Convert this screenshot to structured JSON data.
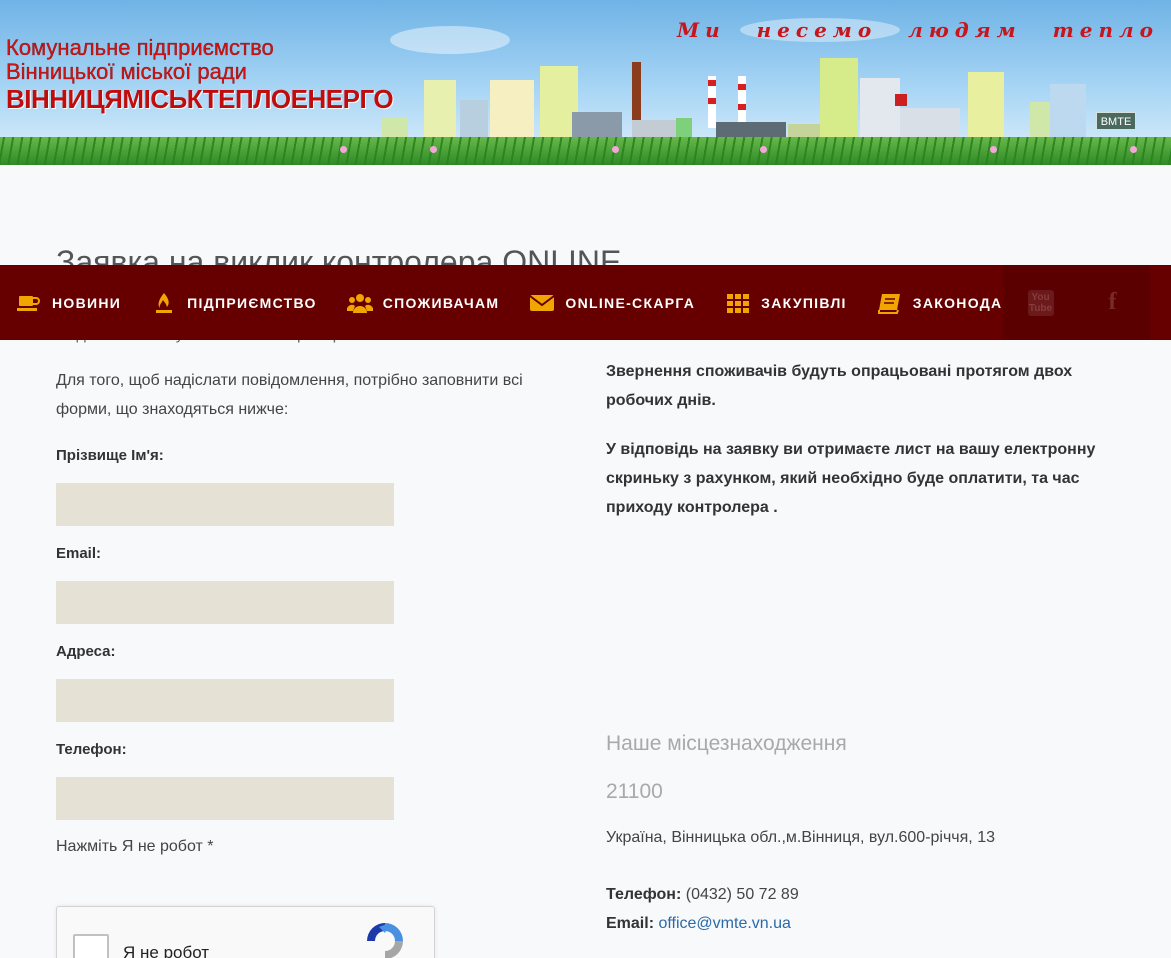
{
  "header": {
    "logo_line1": "Комунальне підприємство",
    "logo_line2": "Вінницької міської ради",
    "logo_line3": "ВІННИЦЯМІСЬКТЕПЛОЕНЕРГО",
    "slogan": "Ми несемо людям тепло",
    "sign": "ВМТЕ"
  },
  "page": {
    "title": "Заявка на виклик контролера ONLINE",
    "subtitle": "Надішліть заявку на виклик контролера"
  },
  "nav": {
    "items": [
      {
        "label": "Новини",
        "icon": "coffee-icon"
      },
      {
        "label": "Підприємство",
        "icon": "fire-icon"
      },
      {
        "label": "Споживачам",
        "icon": "users-icon"
      },
      {
        "label": "Online-скарга",
        "icon": "envelope-icon"
      },
      {
        "label": "Закупівлі",
        "icon": "grid-icon"
      },
      {
        "label": "Законодавство",
        "icon": "book-icon"
      }
    ],
    "youtube": "You Tube",
    "facebook": "f"
  },
  "form": {
    "intro": "Для того, щоб надіслати повідомлення, потрібно заповнити всі форми, що знаходяться нижче:",
    "name_label": "Прізвище Ім'я:",
    "email_label": "Email:",
    "address_label": "Адреса:",
    "phone_label": "Телефон:",
    "name_value": "",
    "email_value": "",
    "address_value": "",
    "phone_value": "",
    "captcha_label": "Нажміть Я не робот *",
    "captcha_text": "Я не робот"
  },
  "info": {
    "note1": "Звернення споживачів будуть опрацьовані протягом двох робочих днів.",
    "note2": "У відповідь на заявку ви отримаєте лист на вашу електронну скриньку з рахунком, який необхідно буде оплатити, та час приходу контролера .",
    "location_title": "Наше місцезнаходження",
    "zip": "21100",
    "address": "Україна, Вінницька обл.,м.Вінниця, вул.600-річчя, 13",
    "phone_label": "Телефон:",
    "phone": "(0432) 50 72 89",
    "email_label": "Email:",
    "email": "office@vmte.vn.ua"
  },
  "colors": {
    "nav_bg": "#660000",
    "nav_icon": "#f0a500",
    "input_bg": "#e6e1d5",
    "logo_red": "#d01414",
    "link": "#2a6aa8"
  }
}
